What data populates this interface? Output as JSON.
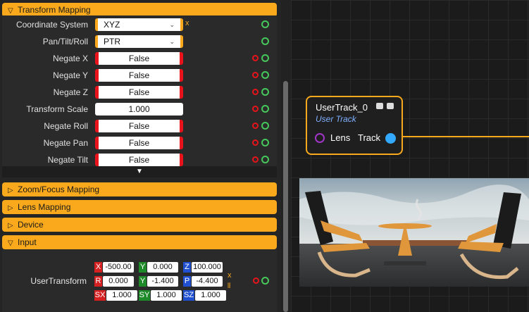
{
  "sections": {
    "transform_mapping": "Transform Mapping",
    "zoom_focus": "Zoom/Focus Mapping",
    "lens": "Lens Mapping",
    "device": "Device",
    "input": "Input"
  },
  "transform_rows": [
    {
      "label": "Coordinate System",
      "value": "XYZ",
      "kind": "combo"
    },
    {
      "label": "Pan/Tilt/Roll",
      "value": "PTR",
      "kind": "combo"
    },
    {
      "label": "Negate X",
      "value": "False",
      "kind": "bool"
    },
    {
      "label": "Negate Y",
      "value": "False",
      "kind": "bool"
    },
    {
      "label": "Negate Z",
      "value": "False",
      "kind": "bool"
    },
    {
      "label": "Transform Scale",
      "value": "1.000",
      "kind": "number"
    },
    {
      "label": "Negate Roll",
      "value": "False",
      "kind": "bool"
    },
    {
      "label": "Negate Pan",
      "value": "False",
      "kind": "bool"
    },
    {
      "label": "Negate Tilt",
      "value": "False",
      "kind": "bool"
    }
  ],
  "input": {
    "label": "UserTransform",
    "rows": [
      [
        {
          "tag": "X",
          "value": "-500.00",
          "color": "#d42020"
        },
        {
          "tag": "Y",
          "value": "0.000",
          "color": "#1e8a2a"
        },
        {
          "tag": "Z",
          "value": "100.000",
          "color": "#2050d0"
        }
      ],
      [
        {
          "tag": "R",
          "value": "0.000",
          "color": "#d42020"
        },
        {
          "tag": "Y",
          "value": "-1.400",
          "color": "#1e8a2a"
        },
        {
          "tag": "P",
          "value": "-4.400",
          "color": "#2050d0"
        }
      ],
      [
        {
          "tag": "SX",
          "value": "1.000",
          "color": "#d42020"
        },
        {
          "tag": "SY",
          "value": "1.000",
          "color": "#1e8a2a"
        },
        {
          "tag": "SZ",
          "value": "1.000",
          "color": "#2050d0"
        }
      ]
    ]
  },
  "node": {
    "title": "UserTrack_0",
    "subtitle": "User Track",
    "in_pin": "Lens",
    "out_pin": "Track"
  },
  "colors": {
    "accent": "#f9a91b",
    "pin_red": "#e8131b",
    "pin_green": "#46c85a",
    "track_pin": "#33aaff",
    "lens_pin": "#a035c8"
  }
}
